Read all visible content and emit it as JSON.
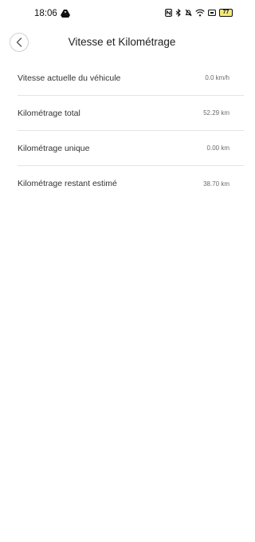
{
  "status_bar": {
    "time": "18:06",
    "battery": "77",
    "icons": [
      "drive-icon",
      "nfc-icon",
      "bluetooth-icon",
      "alarm-icon",
      "wifi-icon",
      "cast-icon",
      "battery-icon"
    ]
  },
  "header": {
    "title": "Vitesse et Kilométrage"
  },
  "rows": [
    {
      "label": "Vitesse actuelle du véhicule",
      "value": "0.0 km/h"
    },
    {
      "label": "Kilométrage total",
      "value": "52.29 km"
    },
    {
      "label": "Kilométrage unique",
      "value": "0.00 km"
    },
    {
      "label": "Kilométrage restant estimé",
      "value": "38.70 km"
    }
  ]
}
